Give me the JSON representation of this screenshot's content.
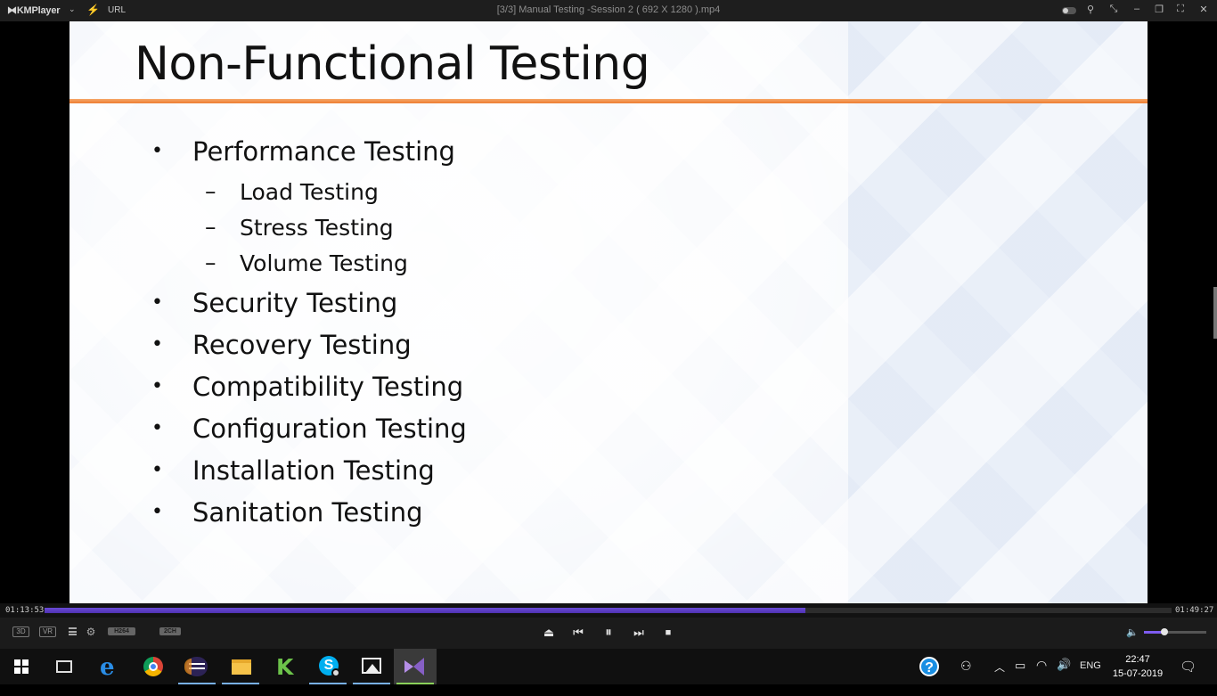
{
  "app": {
    "logo": "KMPlayer",
    "url_label": "URL",
    "window_title": "[3/3] Manual Testing -Session 2 ( 692 X 1280 ).mp4"
  },
  "slide": {
    "title": "Non-Functional Testing",
    "bullets": [
      {
        "text": "Performance Testing",
        "sub": [
          "Load Testing",
          "Stress Testing",
          "Volume Testing"
        ]
      },
      {
        "text": "Security Testing"
      },
      {
        "text": "Recovery Testing"
      },
      {
        "text": "Compatibility Testing"
      },
      {
        "text": "Configuration Testing"
      },
      {
        "text": "Installation Testing"
      },
      {
        "text": "Sanitation Testing"
      }
    ],
    "accent_color": "#ed7d31"
  },
  "playback": {
    "elapsed": "01:13:53",
    "total": "01:49:27",
    "progress_fraction": 0.675,
    "volume_fraction": 0.33,
    "accent_color": "#5b3cc4"
  },
  "controls": {
    "tag_3d": "3D",
    "tag_vr": "VR",
    "codec": "H264",
    "channels": "2CH",
    "icons": [
      "menu-icon",
      "gear-icon",
      "eject-icon",
      "previous-icon",
      "pause-icon",
      "next-icon",
      "stop-icon",
      "volume-icon"
    ]
  },
  "taskbar": {
    "apps": [
      "start-icon",
      "task-view-icon",
      "edge-icon",
      "chrome-icon",
      "eclipse-icon",
      "file-explorer-icon",
      "kmplayer-k-icon",
      "skype-icon",
      "photos-icon",
      "visual-studio-icon"
    ],
    "language": "ENG",
    "time": "22:47",
    "date": "15-07-2019"
  }
}
